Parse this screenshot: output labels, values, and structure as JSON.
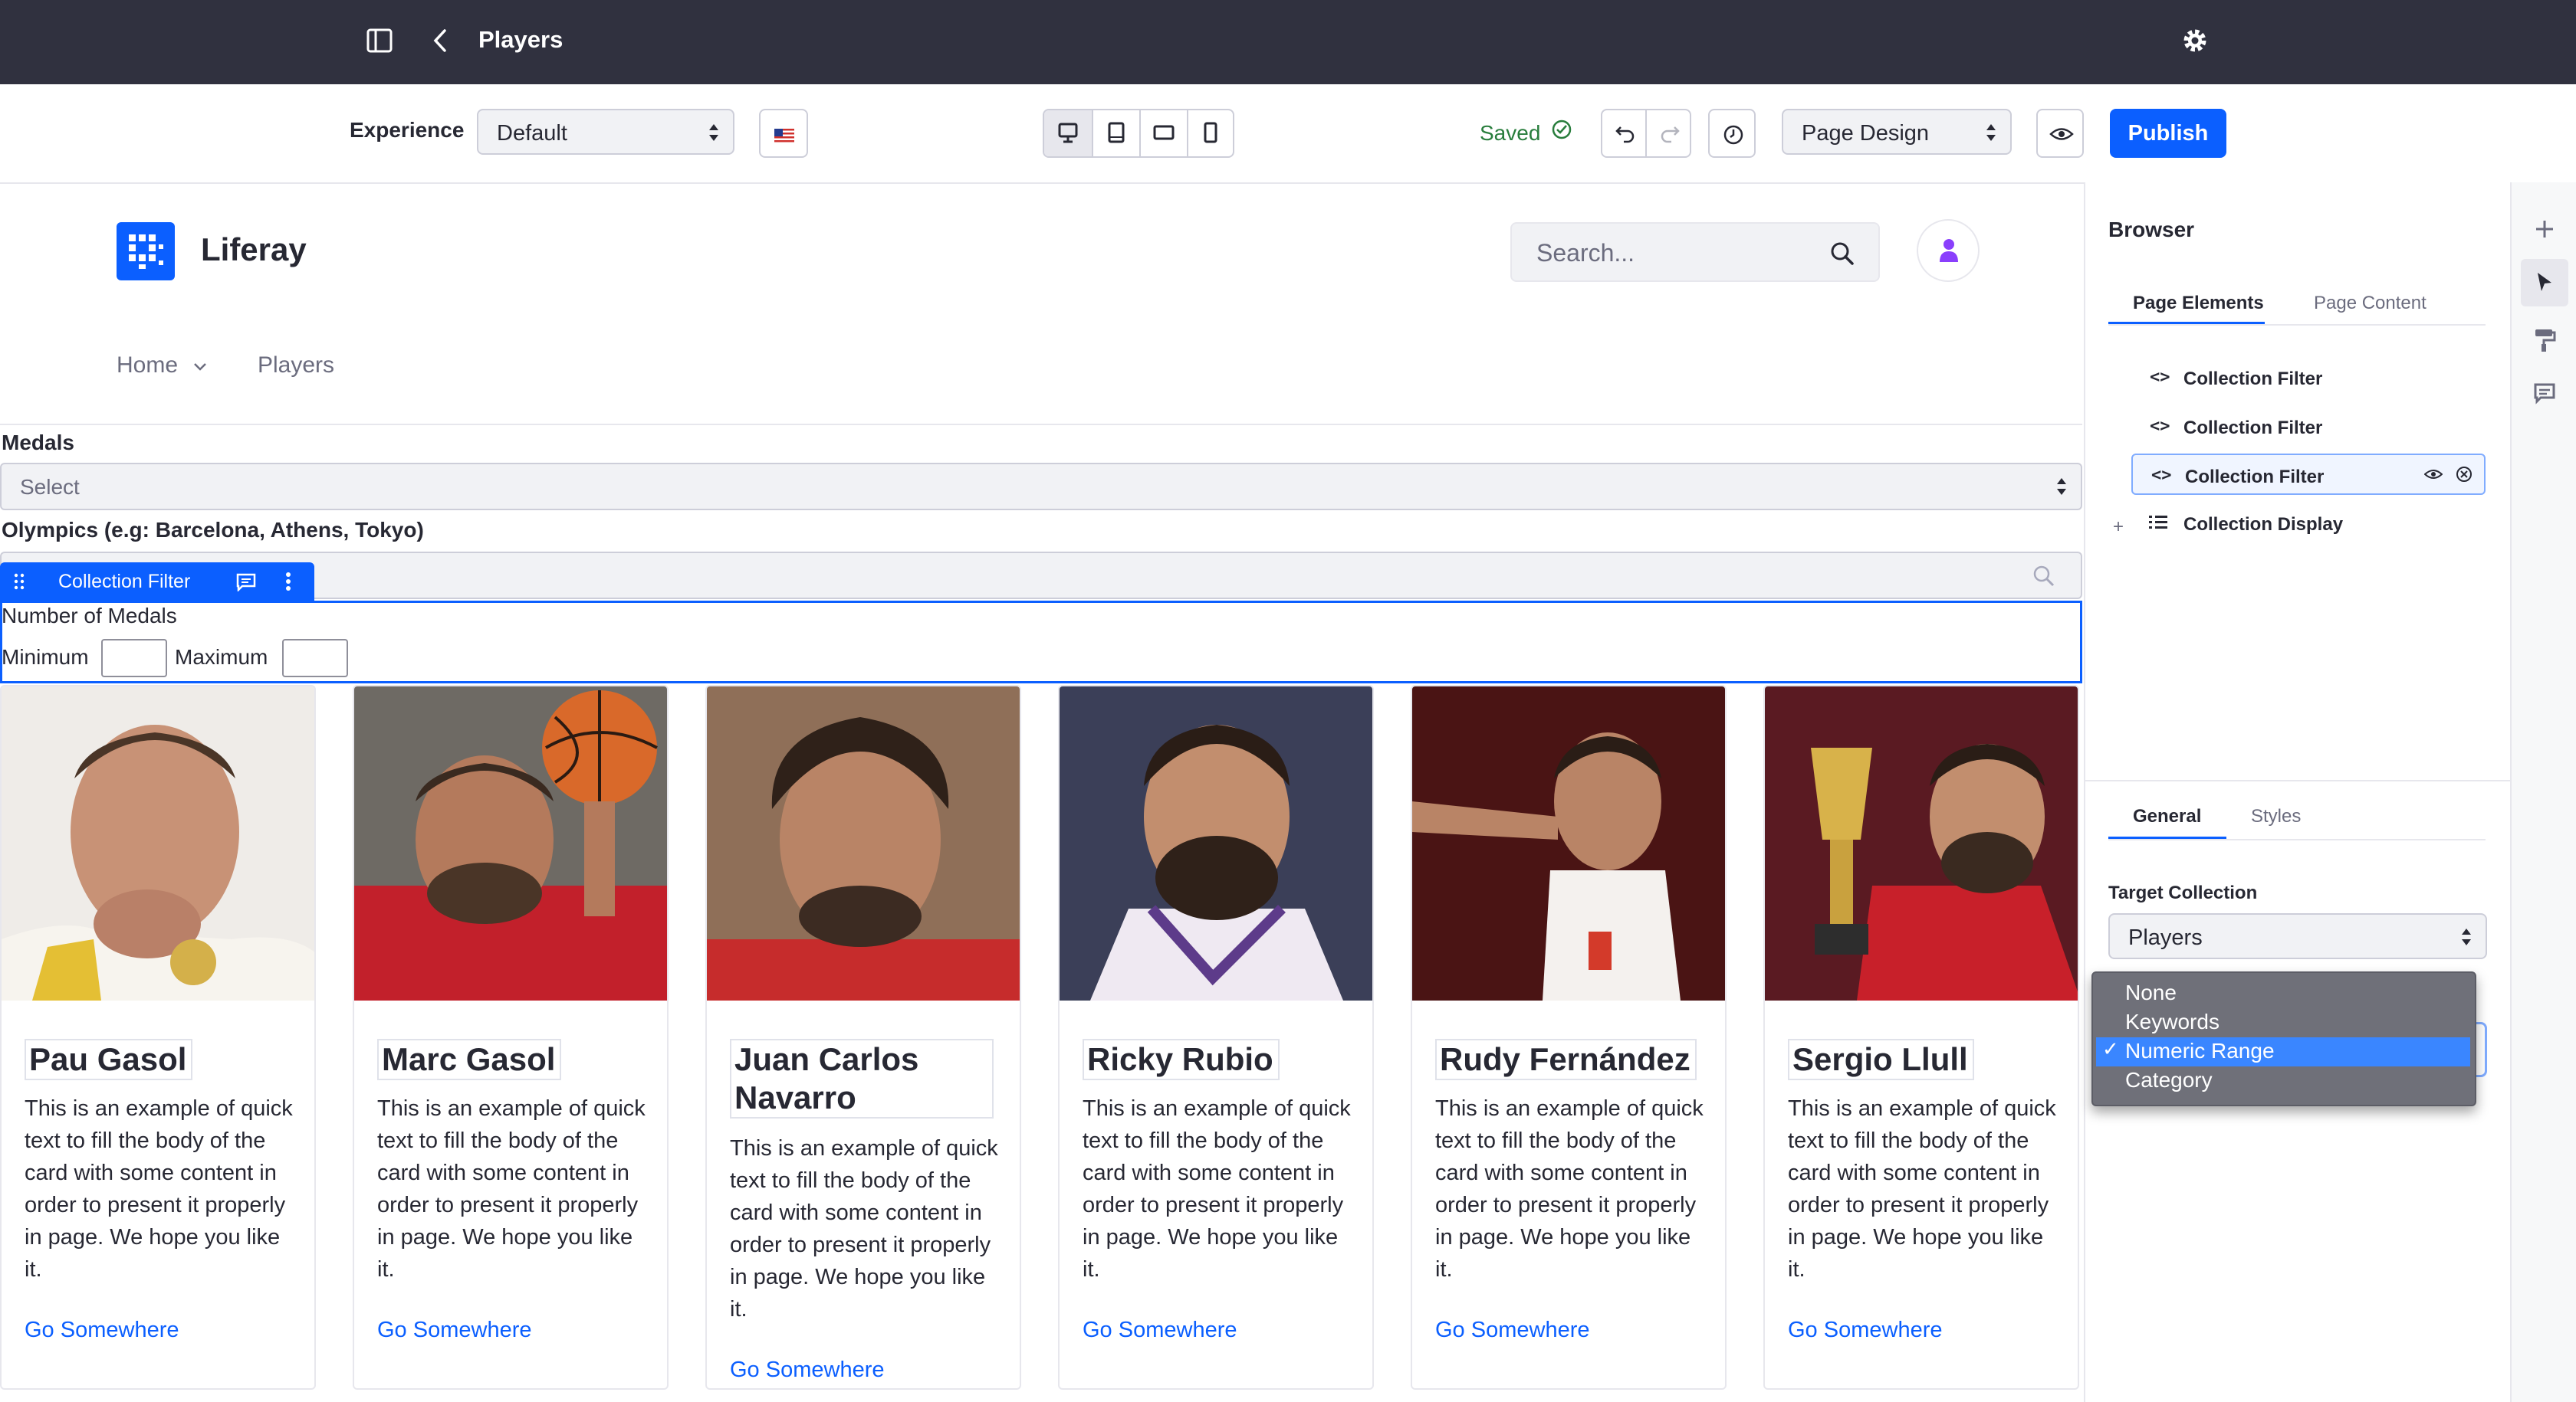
{
  "topbar": {
    "title": "Players"
  },
  "toolbar": {
    "experience_label": "Experience",
    "experience_value": "Default",
    "saved": "Saved",
    "page_design": "Page Design",
    "publish": "Publish"
  },
  "site": {
    "brand": "Liferay",
    "search_placeholder": "Search...",
    "nav": [
      {
        "label": "Home"
      },
      {
        "label": "Players"
      }
    ]
  },
  "filters": {
    "medals_label": "Medals",
    "medals_select": "Select",
    "olympics_label": "Olympics (e.g: Barcelona, Athens, Tokyo)",
    "collection_filter_tag": "Collection Filter",
    "number_of_medals": "Number of Medals",
    "minimum": "Minimum",
    "maximum": "Maximum"
  },
  "cards": [
    {
      "name": "Pau Gasol",
      "body": "This is an example of quick text to fill the body of the card with some content in order to present it properly in page. We hope you like it.",
      "link": "Go Somewhere"
    },
    {
      "name": "Marc Gasol",
      "body": "This is an example of quick text to fill the body of the card with some content in order to present it properly in page. We hope you like it.",
      "link": "Go Somewhere"
    },
    {
      "name": "Juan Carlos Navarro",
      "body": "This is an example of quick text to fill the body of the card with some content in order to present it properly in page. We hope you like it.",
      "link": "Go Somewhere"
    },
    {
      "name": "Ricky Rubio",
      "body": "This is an example of quick text to fill the body of the card with some content in order to present it properly in page. We hope you like it.",
      "link": "Go Somewhere"
    },
    {
      "name": "Rudy Fernández",
      "body": "This is an example of quick text to fill the body of the card with some content in order to present it properly in page. We hope you like it.",
      "link": "Go Somewhere"
    },
    {
      "name": "Sergio Llull",
      "body": "This is an example of quick text to fill the body of the card with some content in order to present it properly in page. We hope you like it.",
      "link": "Go Somewhere"
    }
  ],
  "panel": {
    "browser_title": "Browser",
    "tabs": [
      "Page Elements",
      "Page Content"
    ],
    "tree": [
      "Collection Filter",
      "Collection Filter",
      "Collection Filter",
      "Collection Display"
    ],
    "config_tabs": [
      "General",
      "Styles"
    ],
    "target_collection_label": "Target Collection",
    "target_collection_value": "Players",
    "dropdown_options": [
      "None",
      "Keywords",
      "Numeric Range",
      "Category"
    ],
    "dropdown_selected": "Numeric Range"
  },
  "colors": {
    "accent": "#0b5fff",
    "topbar": "#30313f",
    "saved": "#287d3c"
  }
}
